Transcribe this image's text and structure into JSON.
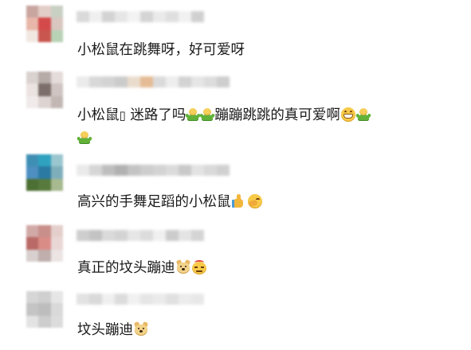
{
  "comments": [
    {
      "text": "小松鼠在跳舞呀，好可爱呀",
      "avatar_colors": [
        "#c9a5a0",
        "#e3cdc7",
        "#c8d0c4",
        "#e8b7a9",
        "#d44a4a",
        "#d9c7c0",
        "#f1e8e2",
        "#c9564f",
        "#b8d2b5"
      ],
      "username_colors": [
        "#d6d6d6",
        "#eeeeee",
        "#cfcfcf",
        "#e4e4e4",
        "#f2f2f2",
        "#d0d0d0",
        "#e8e8e8",
        "#dcdcdc",
        "#f0f0f0",
        "#cccccc"
      ]
    },
    {
      "text_parts": [
        "小松鼠",
        "迷路了吗",
        "蹦蹦跳跳的真可爱啊"
      ],
      "box_glyph": "▯",
      "avatar_colors": [
        "#d9d2cf",
        "#b7aba8",
        "#e4dcda",
        "#ebe3e0",
        "#7c6e6a",
        "#cfc4c1",
        "#f0ebea",
        "#ddd4d2",
        "#c3b7b4"
      ],
      "username_colors": [
        "#e9e9e9",
        "#d4d4d4",
        "#cfcfcf",
        "#c6c6c6",
        "#e8d9c8",
        "#e2b48a",
        "#d7d7d7",
        "#ececec",
        "#cfcfcf",
        "#e3e3e3",
        "#d9d9d9",
        "#c9c9c9"
      ]
    },
    {
      "text": "高兴的手舞足蹈的小松鼠",
      "avatar_colors": [
        "#3f8fb5",
        "#2fa2c0",
        "#9ac6cf",
        "#4d8fc0",
        "#2b7aa3",
        "#7faebb",
        "#4c6f33",
        "#587a3d",
        "#a7b98f"
      ],
      "username_colors": [
        "#e8e8e8",
        "#d2d2d2",
        "#b8b8b8",
        "#a9a9a9",
        "#bdbdbd",
        "#c8c8c8",
        "#cfcfcf",
        "#d8d8d8",
        "#c4c4c4",
        "#e0e0e0",
        "#d5d5d5",
        "#cccccc"
      ]
    },
    {
      "text": "真正的坟头蹦迪",
      "avatar_colors": [
        "#d1a9a6",
        "#c98f8a",
        "#e4cfcc",
        "#b96a66",
        "#d98c86",
        "#e9d7d5",
        "#d8d0cf",
        "#bfaeac",
        "#ebe4e3"
      ],
      "username_colors": [
        "#c9c9c9",
        "#bdbdbd",
        "#d6d6d6",
        "#cfcfcf",
        "#e4e4e4",
        "#d9d9d9",
        "#efefef",
        "#c7c7c7",
        "#e2e2e2",
        "#d0d0d0"
      ]
    },
    {
      "text": "坟头蹦迪",
      "avatar_colors": [
        "#d6d6d6",
        "#cfcfcf",
        "#e6e6e6",
        "#c4c4c4",
        "#bdbdbd",
        "#d9d9d9",
        "#e3e3e3",
        "#cdcdcd",
        "#dcdcdc"
      ],
      "username_colors": [
        "#e0e0e0",
        "#d5d5d5",
        "#eeeeee",
        "#d9d9d9",
        "#f0f0f0",
        "#e4e4e4",
        "#e9e9e9",
        "#dedede",
        "#eaeaea",
        "#e6e6e6"
      ]
    }
  ],
  "emoji": {
    "sprout": "green-doll-emoji",
    "grin": "grinning-face-emoji",
    "thumb": "thumbs-up-emoji",
    "laugh": "laughing-cover-face-emoji",
    "doge": "doge-emoji",
    "smirk": "devil-smirk-emoji"
  }
}
